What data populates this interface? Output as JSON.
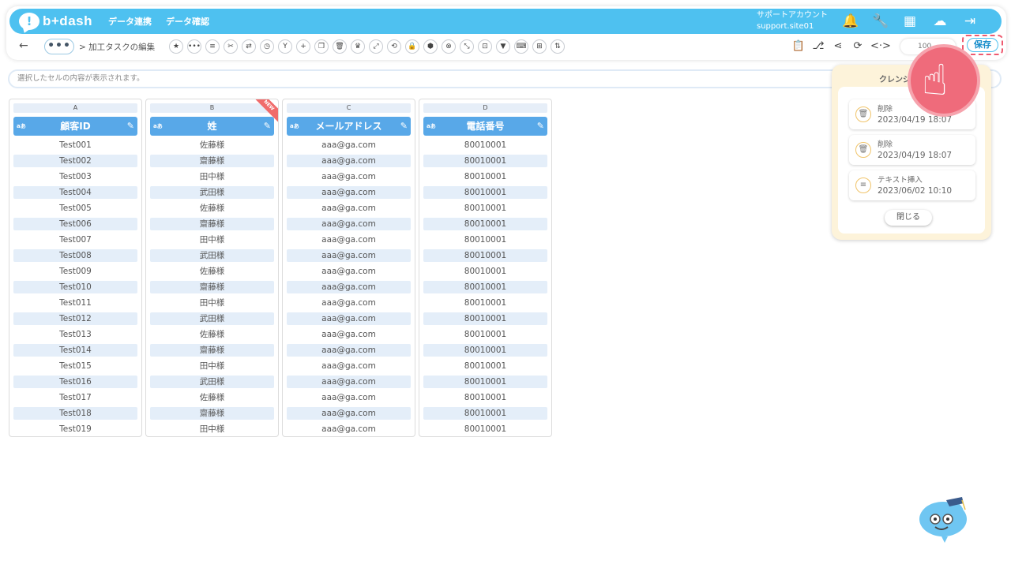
{
  "header": {
    "logo_text": "b+dash",
    "nav": [
      "データ連携",
      "データ確認"
    ],
    "account_name": "サポートアカウント",
    "site_name": "support.site01",
    "icons": [
      "bell-icon",
      "wrench-icon",
      "grid-icon",
      "chat-icon",
      "logout-icon"
    ]
  },
  "toolbar": {
    "back_glyph": "←",
    "more_glyph": "•••",
    "breadcrumb": "> 加工タスクの編集",
    "tools": [
      "★",
      "•••",
      "≡",
      "✂",
      "⇄",
      "◷",
      "Y",
      "+",
      "❐",
      "🗑",
      "♛",
      "⤢",
      "⟲",
      "🔒",
      "⬢",
      "⊗",
      "⤡",
      "⊡",
      "▼",
      "⌨",
      "⊞",
      "⇅"
    ],
    "right_tools": [
      "📋",
      "⎇",
      "⋖",
      "⟳",
      "<·>"
    ],
    "zoom": "100",
    "save_label": "保存"
  },
  "cell_bar": {
    "placeholder": "選択したセルの内容が表示されます。"
  },
  "columns": [
    {
      "letter": "A",
      "type": "aあ",
      "title": "顧客ID",
      "new": false,
      "rows": [
        "Test001",
        "Test002",
        "Test003",
        "Test004",
        "Test005",
        "Test006",
        "Test007",
        "Test008",
        "Test009",
        "Test010",
        "Test011",
        "Test012",
        "Test013",
        "Test014",
        "Test015",
        "Test016",
        "Test017",
        "Test018",
        "Test019"
      ]
    },
    {
      "letter": "B",
      "type": "aあ",
      "title": "姓",
      "new": true,
      "badge": "NEW",
      "rows": [
        "佐藤様",
        "齋藤様",
        "田中様",
        "武田様",
        "佐藤様",
        "齋藤様",
        "田中様",
        "武田様",
        "佐藤様",
        "齋藤様",
        "田中様",
        "武田様",
        "佐藤様",
        "齋藤様",
        "田中様",
        "武田様",
        "佐藤様",
        "齋藤様",
        "田中様"
      ]
    },
    {
      "letter": "C",
      "type": "aあ",
      "title": "メールアドレス",
      "new": false,
      "rows": [
        "aaa@ga.com",
        "aaa@ga.com",
        "aaa@ga.com",
        "aaa@ga.com",
        "aaa@ga.com",
        "aaa@ga.com",
        "aaa@ga.com",
        "aaa@ga.com",
        "aaa@ga.com",
        "aaa@ga.com",
        "aaa@ga.com",
        "aaa@ga.com",
        "aaa@ga.com",
        "aaa@ga.com",
        "aaa@ga.com",
        "aaa@ga.com",
        "aaa@ga.com",
        "aaa@ga.com",
        "aaa@ga.com"
      ]
    },
    {
      "letter": "D",
      "type": "aあ",
      "title": "電話番号",
      "new": false,
      "rows": [
        "80010001",
        "80010001",
        "80010001",
        "80010001",
        "80010001",
        "80010001",
        "80010001",
        "80010001",
        "80010001",
        "80010001",
        "80010001",
        "80010001",
        "80010001",
        "80010001",
        "80010001",
        "80010001",
        "80010001",
        "80010001",
        "80010001"
      ]
    }
  ],
  "history_panel": {
    "title": "クレンジ",
    "items": [
      {
        "icon": "trash-icon",
        "glyph": "🗑",
        "label": "削除",
        "time": "2023/04/19 18:07"
      },
      {
        "icon": "trash-icon",
        "glyph": "🗑",
        "label": "削除",
        "time": "2023/04/19 18:07"
      },
      {
        "icon": "text-insert-icon",
        "glyph": "≡",
        "label": "テキスト挿入",
        "time": "2023/06/02 10:10"
      }
    ],
    "close_label": "閉じる"
  }
}
